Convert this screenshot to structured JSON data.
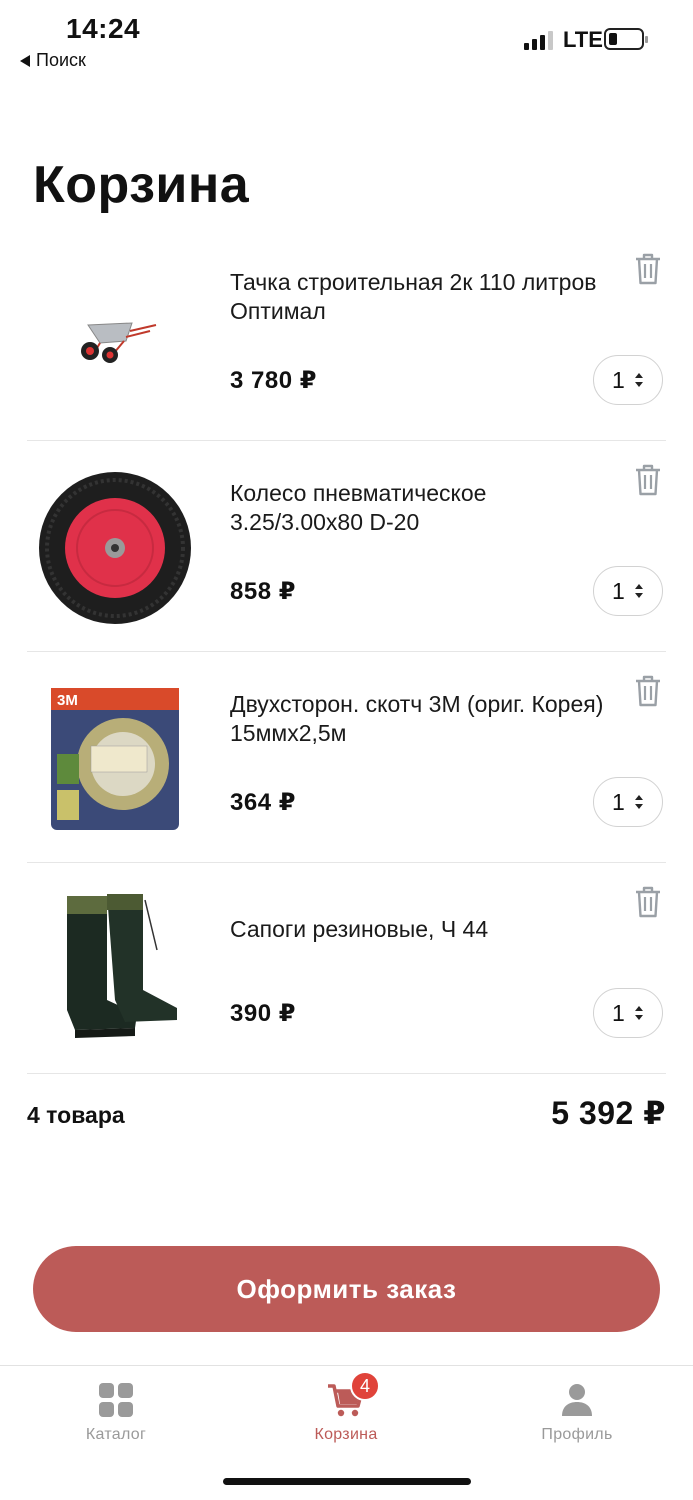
{
  "status_bar": {
    "time": "14:24",
    "back_label": "Поиск",
    "network": "LTE"
  },
  "page": {
    "title": "Корзина"
  },
  "cart": {
    "items": [
      {
        "name": "Тачка строительная 2к 110 литров Оптимал",
        "price": "3 780 ₽",
        "quantity": "1",
        "image": "wheelbarrow"
      },
      {
        "name": "Колесо пневматическое 3.25/3.00x80 D-20",
        "price": "858 ₽",
        "quantity": "1",
        "image": "wheel"
      },
      {
        "name": "Двухсторон. скотч 3М (ориг. Корея) 15ммх2,5м",
        "price": "364 ₽",
        "quantity": "1",
        "image": "tape-package"
      },
      {
        "name": "Сапоги резиновые, Ч 44",
        "price": "390 ₽",
        "quantity": "1",
        "image": "rubber-boots"
      }
    ],
    "tape_brand": "3M"
  },
  "summary": {
    "count_label": "4 товара",
    "total": "5 392 ₽"
  },
  "checkout": {
    "label": "Оформить заказ"
  },
  "tab_bar": {
    "tabs": [
      {
        "label": "Каталог",
        "icon": "grid-icon",
        "active": false
      },
      {
        "label": "Корзина",
        "icon": "cart-icon",
        "active": true,
        "badge": "4"
      },
      {
        "label": "Профиль",
        "icon": "person-icon",
        "active": false
      }
    ]
  },
  "colors": {
    "accent": "#bc5b58",
    "badge": "#e0433a",
    "muted_icon": "#9a9a9a"
  }
}
